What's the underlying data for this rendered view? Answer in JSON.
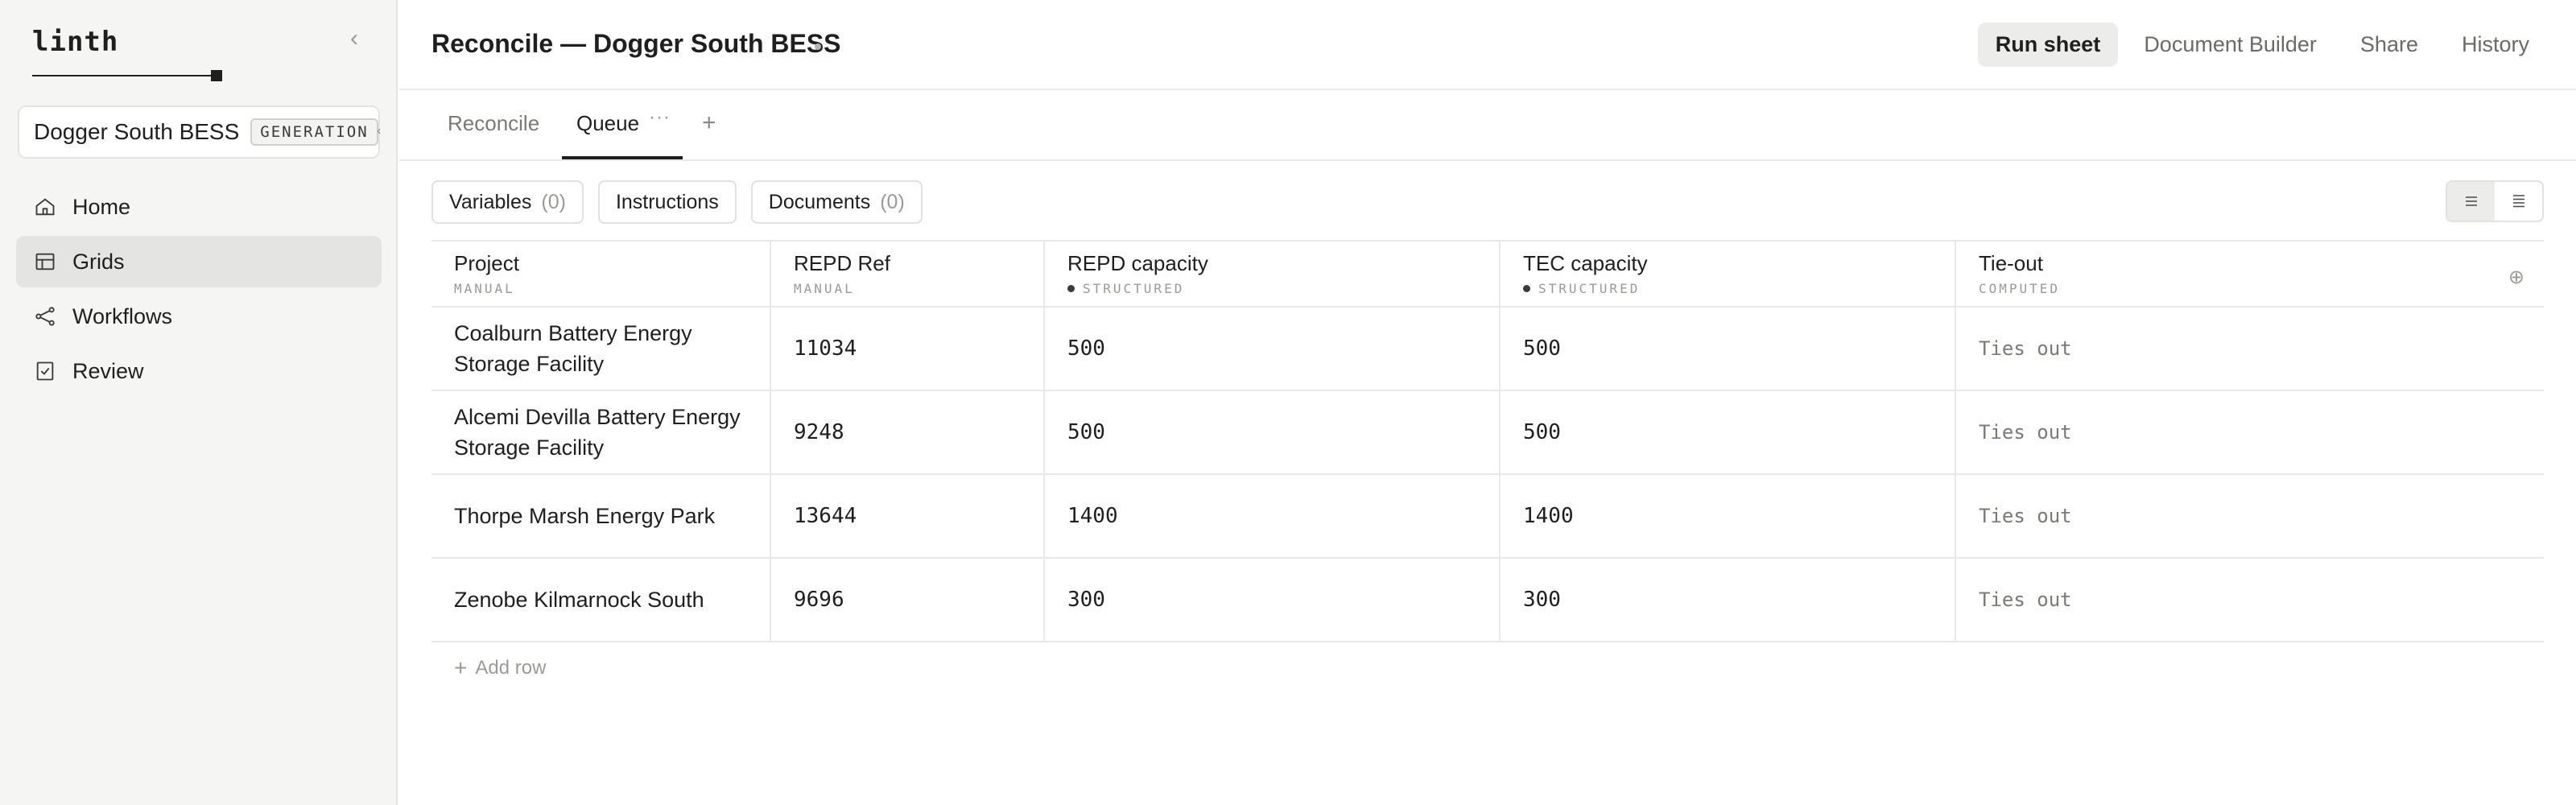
{
  "app": {
    "logo": "linth"
  },
  "workspace": {
    "name": "Dogger South BESS",
    "badge": "GENERATION"
  },
  "sidebar": {
    "items": [
      {
        "label": "Home",
        "icon": "home-icon"
      },
      {
        "label": "Grids",
        "icon": "grid-icon",
        "active": true
      },
      {
        "label": "Workflows",
        "icon": "workflow-icon"
      },
      {
        "label": "Review",
        "icon": "review-icon"
      }
    ]
  },
  "header": {
    "title": "Reconcile — Dogger South BESS",
    "actions": {
      "run_sheet": "Run sheet",
      "document_builder": "Document Builder",
      "share": "Share",
      "history": "History"
    }
  },
  "tabs": {
    "reconcile": "Reconcile",
    "queue": "Queue",
    "more": "···",
    "add": "+"
  },
  "toolbar": {
    "variables": {
      "label": "Variables",
      "count": "(0)"
    },
    "instructions": {
      "label": "Instructions"
    },
    "documents": {
      "label": "Documents",
      "count": "(0)"
    }
  },
  "table": {
    "columns": [
      {
        "title": "Project",
        "type": "MANUAL"
      },
      {
        "title": "REPD Ref",
        "type": "MANUAL"
      },
      {
        "title": "REPD capacity",
        "type": "STRUCTURED"
      },
      {
        "title": "TEC capacity",
        "type": "STRUCTURED"
      },
      {
        "title": "Tie-out",
        "type": "COMPUTED"
      }
    ],
    "rows": [
      {
        "project": "Coalburn Battery Energy Storage Facility",
        "repd_ref": "11034",
        "repd_capacity": "500",
        "tec_capacity": "500",
        "tie_out": "Ties out"
      },
      {
        "project": "Alcemi Devilla Battery Energy Storage Facility",
        "repd_ref": "9248",
        "repd_capacity": "500",
        "tec_capacity": "500",
        "tie_out": "Ties out"
      },
      {
        "project": "Thorpe Marsh Energy Park",
        "repd_ref": "13644",
        "repd_capacity": "1400",
        "tec_capacity": "1400",
        "tie_out": "Ties out"
      },
      {
        "project": "Zenobe Kilmarnock South",
        "repd_ref": "9696",
        "repd_capacity": "300",
        "tec_capacity": "300",
        "tie_out": "Ties out"
      }
    ],
    "add_row": "Add row"
  }
}
